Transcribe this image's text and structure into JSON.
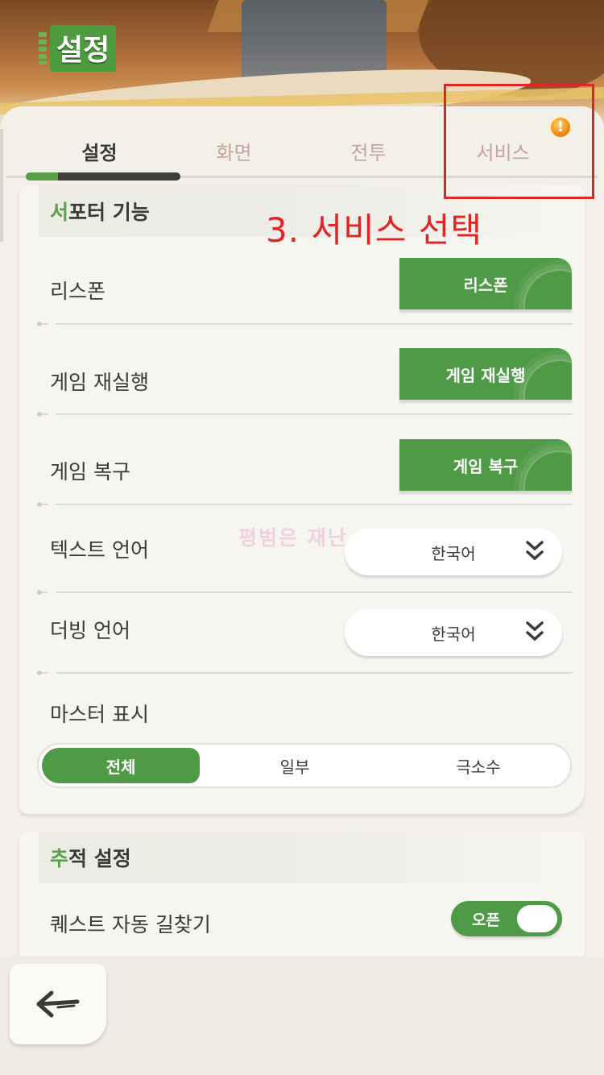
{
  "header": {
    "title": "설정"
  },
  "tabs": [
    {
      "label": "설정",
      "active": true
    },
    {
      "label": "화면",
      "active": false
    },
    {
      "label": "전투",
      "active": false
    },
    {
      "label": "서비스",
      "active": false,
      "alert": true
    }
  ],
  "alert_icon": "!",
  "annotation": {
    "text": "3. 서비스 선택",
    "color": "#e32424"
  },
  "watermark": "평범은 재난",
  "support": {
    "title_first": "서",
    "title_rest": "포터 기능",
    "rows": [
      {
        "label": "리스폰",
        "button": "리스폰"
      },
      {
        "label": "게임 재실행",
        "button": "게임 재실행"
      },
      {
        "label": "게임 복구",
        "button": "게임 복구"
      }
    ],
    "text_language": {
      "label": "텍스트 언어",
      "value": "한국어"
    },
    "dubbing_language": {
      "label": "더빙 언어",
      "value": "한국어"
    },
    "master_display": {
      "label": "마스터 표시",
      "options": [
        "전체",
        "일부",
        "극소수"
      ],
      "selected": "전체"
    }
  },
  "tracking": {
    "title_first": "추",
    "title_rest": "적 설정",
    "quest_autopath": {
      "label": "퀘스트 자동 길찾기",
      "toggle_label": "오픈",
      "on": true
    }
  },
  "colors": {
    "accent_green": "#4f9a46",
    "tab_inactive": "#c4a79a",
    "annotation_red": "#e32424"
  },
  "icons": {
    "back": "back-arrow-icon",
    "dropdown": "double-chevron-down-icon",
    "alert": "alert-badge-icon"
  }
}
